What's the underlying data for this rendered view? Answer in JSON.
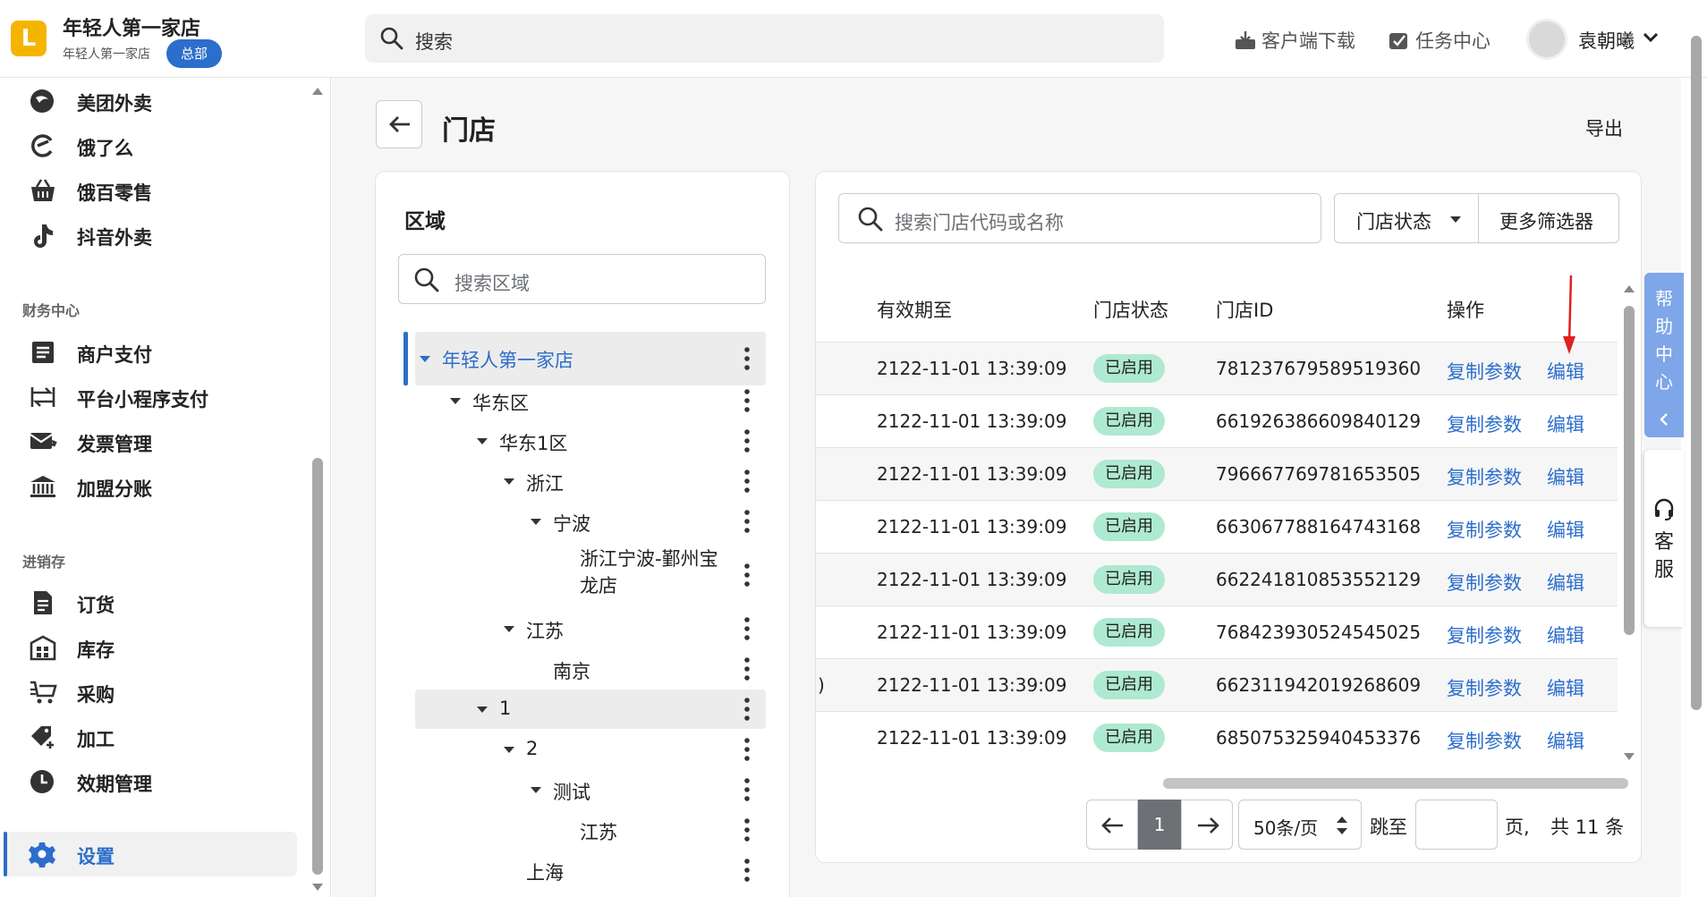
{
  "header": {
    "brand_title": "年轻人第一家店",
    "brand_subtitle": "年轻人第一家店",
    "brand_badge": "总部",
    "search_placeholder": "搜索",
    "download_label": "客户端下载",
    "tasks_label": "任务中心",
    "user_name": "袁朝曦"
  },
  "sidebar": {
    "group1": [
      {
        "icon": "meituan-icon",
        "label": "美团外卖"
      },
      {
        "icon": "eleme-icon",
        "label": "饿了么"
      },
      {
        "icon": "basket-icon",
        "label": "饿百零售"
      },
      {
        "icon": "tiktok-icon",
        "label": "抖音外卖"
      }
    ],
    "finance_title": "财务中心",
    "finance": [
      {
        "icon": "receipt-icon",
        "label": "商户支付"
      },
      {
        "icon": "exchange-icon",
        "label": "平台小程序支付"
      },
      {
        "icon": "invoice-icon",
        "label": "发票管理"
      },
      {
        "icon": "bank-icon",
        "label": "加盟分账"
      }
    ],
    "inventory_title": "进销存",
    "inventory": [
      {
        "icon": "order-icon",
        "label": "订货"
      },
      {
        "icon": "warehouse-icon",
        "label": "库存"
      },
      {
        "icon": "cart-icon",
        "label": "采购"
      },
      {
        "icon": "tag-icon",
        "label": "加工"
      },
      {
        "icon": "clock-icon",
        "label": "效期管理"
      }
    ],
    "settings_label": "设置"
  },
  "page": {
    "title": "门店",
    "export_label": "导出"
  },
  "region": {
    "title": "区域",
    "search_placeholder": "搜索区域",
    "tree": [
      {
        "label": "年轻人第一家店",
        "has_caret": true
      },
      {
        "label": "华东区",
        "has_caret": true
      },
      {
        "label": "华东1区",
        "has_caret": true
      },
      {
        "label": "浙江",
        "has_caret": true
      },
      {
        "label": "宁波",
        "has_caret": true
      },
      {
        "label": "浙江宁波-鄞州宝",
        "label2": "龙店",
        "has_caret": false
      },
      {
        "label": "江苏",
        "has_caret": true
      },
      {
        "label": "南京",
        "has_caret": false
      },
      {
        "label": "1",
        "has_caret": true
      },
      {
        "label": "2",
        "has_caret": true
      },
      {
        "label": "测试",
        "has_caret": true
      },
      {
        "label": "江苏",
        "has_caret": false
      },
      {
        "label": "上海",
        "has_caret": false
      }
    ]
  },
  "stores": {
    "search_placeholder": "搜索门店代码或名称",
    "status_filter": "门店状态",
    "more_filters": "更多筛选器",
    "columns": {
      "expiry": "有效期至",
      "status": "门店状态",
      "id": "门店ID",
      "actions": "操作"
    },
    "copy_label": "复制参数",
    "edit_label": "编辑",
    "rows": [
      {
        "expiry": "2122-11-01 13:39:09",
        "status": "已启用",
        "id": "781237679589519360"
      },
      {
        "expiry": "2122-11-01 13:39:09",
        "status": "已启用",
        "id": "661926386609840129"
      },
      {
        "expiry": "2122-11-01 13:39:09",
        "status": "已启用",
        "id": "796667769781653505"
      },
      {
        "expiry": "2122-11-01 13:39:09",
        "status": "已启用",
        "id": "663067788164743168"
      },
      {
        "expiry": "2122-11-01 13:39:09",
        "status": "已启用",
        "id": "662241810853552129"
      },
      {
        "expiry": "2122-11-01 13:39:09",
        "status": "已启用",
        "id": "768423930524545025"
      },
      {
        "expiry": "2122-11-01 13:39:09",
        "status": "已启用",
        "id": "662311942019268609",
        "prefix": ")"
      },
      {
        "expiry": "2122-11-01 13:39:09",
        "status": "已启用",
        "id": "685075325940453376"
      }
    ]
  },
  "pagination": {
    "current_page": "1",
    "page_size": "50条/页",
    "jump_label": "跳至",
    "page_suffix": "页,",
    "total": "共 11 条"
  },
  "floating": {
    "help_chars": [
      "帮",
      "助",
      "中",
      "心"
    ],
    "service_chars": [
      "客",
      "服"
    ]
  },
  "colors": {
    "accent": "#2c6ecb",
    "badge_bg": "#aee9d1",
    "help_bg": "#7ea6e8",
    "arrow": "#e02020"
  }
}
